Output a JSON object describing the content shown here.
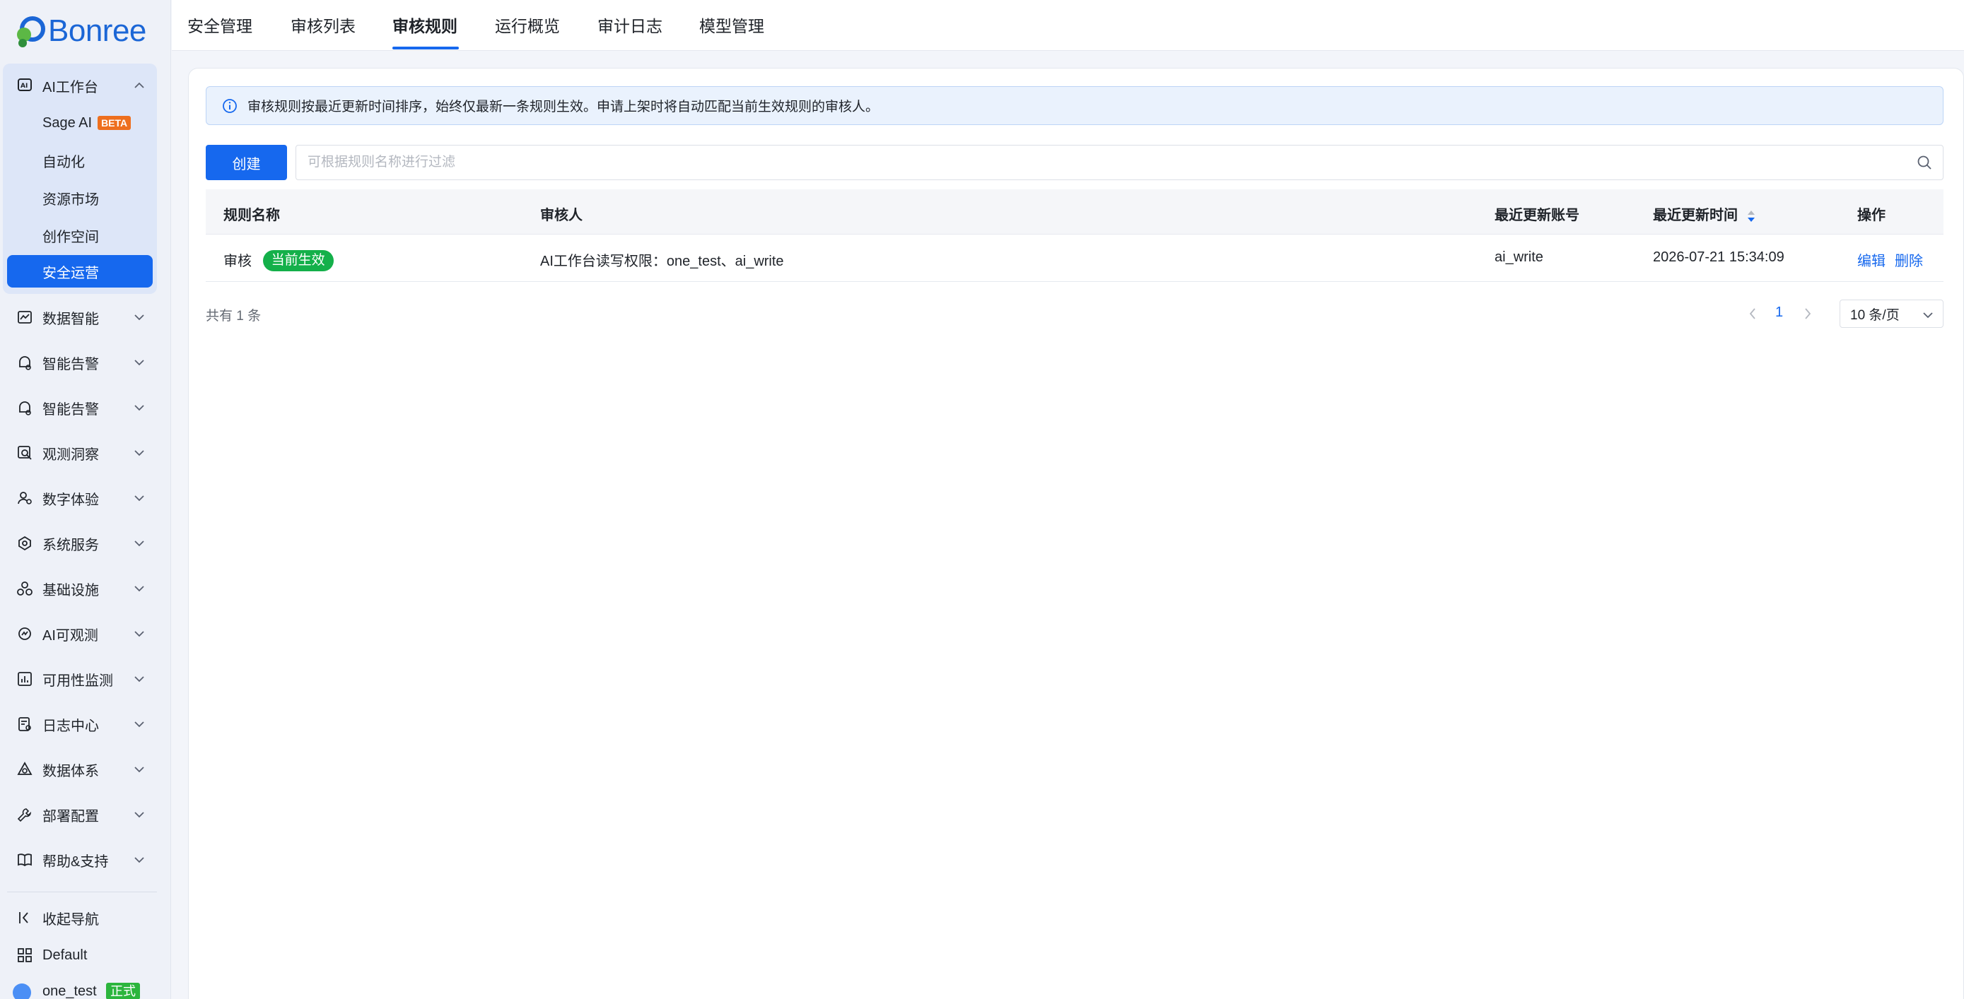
{
  "brand": {
    "logo_text": "Bonree"
  },
  "sidebar": {
    "ai_workbench": "AI工作台",
    "sub_items": [
      {
        "label": "Sage AI",
        "badge": "BETA"
      },
      {
        "label": "自动化"
      },
      {
        "label": "资源市场"
      },
      {
        "label": "创作空间"
      },
      {
        "label": "安全运营",
        "active": true
      }
    ],
    "groups": [
      {
        "label": "数据智能",
        "icon": "chart-line-icon"
      },
      {
        "label": "智能告警",
        "icon": "alarm-bell-icon"
      },
      {
        "label": "智能告警",
        "icon": "alarm-bell-icon"
      },
      {
        "label": "观测洞察",
        "icon": "search-insight-icon"
      },
      {
        "label": "数字体验",
        "icon": "user-experience-icon"
      },
      {
        "label": "系统服务",
        "icon": "system-service-icon"
      },
      {
        "label": "基础设施",
        "icon": "infrastructure-icon"
      },
      {
        "label": "AI可观测",
        "icon": "ai-observe-icon"
      },
      {
        "label": "可用性监测",
        "icon": "availability-chart-icon"
      },
      {
        "label": "日志中心",
        "icon": "log-document-icon"
      },
      {
        "label": "数据体系",
        "icon": "data-system-icon"
      },
      {
        "label": "部署配置",
        "icon": "wrench-icon"
      },
      {
        "label": "帮助&支持",
        "icon": "book-help-icon"
      }
    ],
    "footer": {
      "collapse_label": "收起导航",
      "workspace_label": "Default",
      "user_name": "one_test",
      "user_tag": "正式"
    }
  },
  "tabs": [
    {
      "label": "安全管理"
    },
    {
      "label": "审核列表"
    },
    {
      "label": "审核规则",
      "active": true
    },
    {
      "label": "运行概览"
    },
    {
      "label": "审计日志"
    },
    {
      "label": "模型管理"
    }
  ],
  "notice": {
    "text": "审核规则按最近更新时间排序，始终仅最新一条规则生效。申请上架时将自动匹配当前生效规则的审核人。"
  },
  "toolbar": {
    "create_label": "创建",
    "search_placeholder": "可根据规则名称进行过滤"
  },
  "table": {
    "columns": [
      "规则名称",
      "审核人",
      "最近更新账号",
      "最近更新时间",
      "操作"
    ],
    "rows": [
      {
        "name": "审核",
        "status": "当前生效",
        "reviewers": "AI工作台读写权限：one_test、ai_write",
        "updated_by": "ai_write",
        "updated_at": "2026-07-21 15:34:09",
        "actions": {
          "edit": "编辑",
          "delete": "删除"
        }
      }
    ]
  },
  "pagination": {
    "total_text": "共有 1 条",
    "current_page": "1",
    "page_size": "10 条/页"
  },
  "colors": {
    "primary": "#1668ee",
    "status_green": "#14b04a",
    "beta_orange": "#ee6f1e",
    "sidebar_bg": "#eef1f8"
  }
}
